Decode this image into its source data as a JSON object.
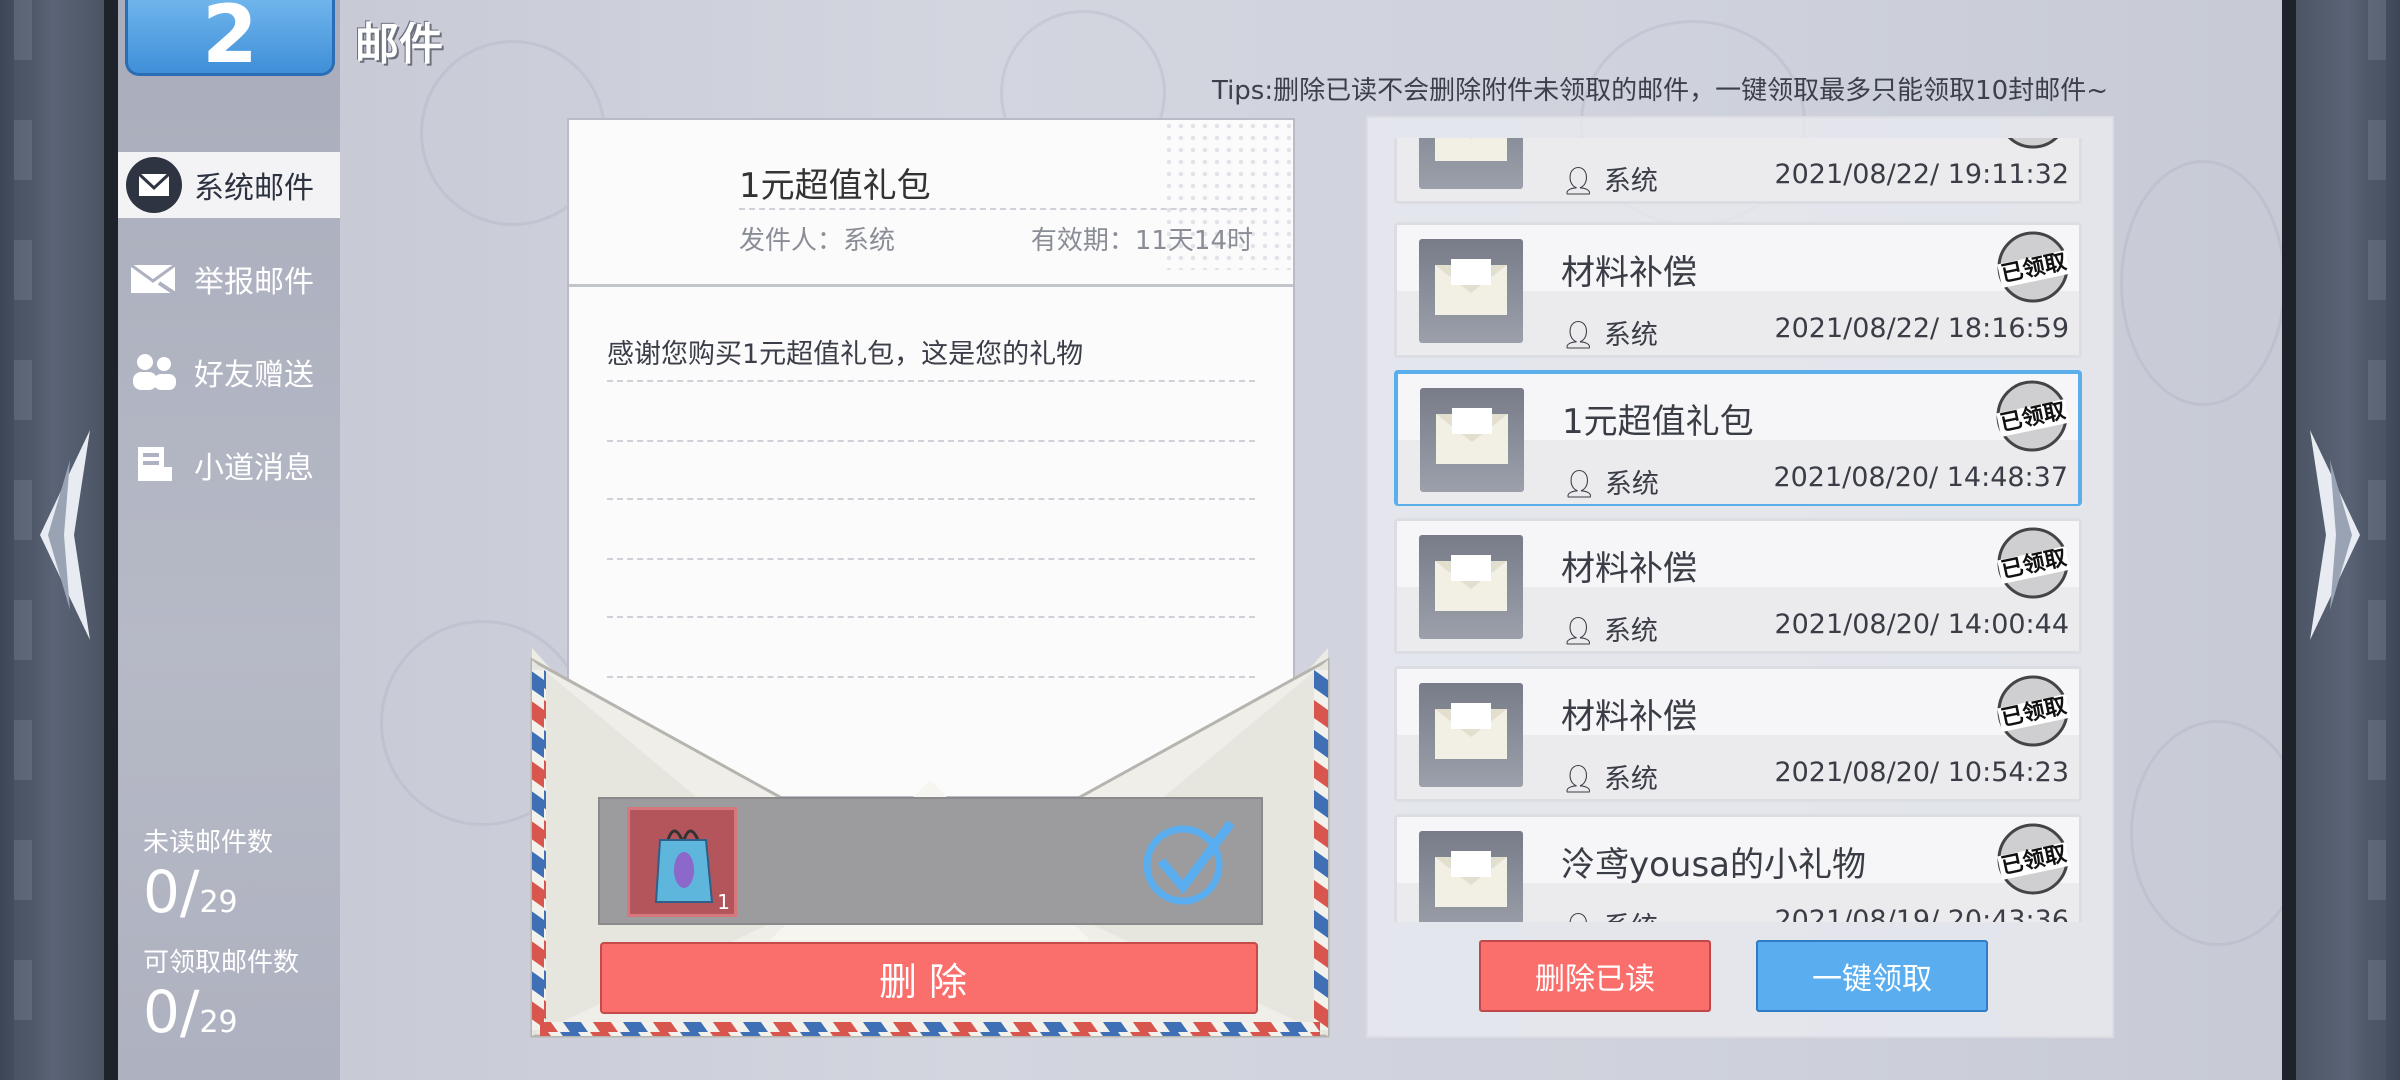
{
  "header": {
    "title": "邮件",
    "back_number": "2"
  },
  "tips": "Tips:删除已读不会删除附件未领取的邮件，一键领取最多只能领取10封邮件~",
  "sidebar": {
    "items": [
      {
        "label": "系统邮件",
        "icon": "mail-icon",
        "active": true
      },
      {
        "label": "举报邮件",
        "icon": "report-mail-icon",
        "active": false
      },
      {
        "label": "好友赠送",
        "icon": "friends-icon",
        "active": false
      },
      {
        "label": "小道消息",
        "icon": "news-icon",
        "active": false
      }
    ],
    "unread_label": "未读邮件数",
    "unread_value": "0/",
    "unread_total": "29",
    "claimable_label": "可领取邮件数",
    "claimable_value": "0/",
    "claimable_total": "29"
  },
  "detail": {
    "title": "1元超值礼包",
    "sender": "发件人：系统",
    "expiry": "有效期：11天14时",
    "body": "感谢您购买1元超值礼包，这是您的礼物",
    "attachment_count": "1",
    "delete_label": "删除"
  },
  "mail_list": [
    {
      "title": "",
      "sender": "系统",
      "time": "2021/08/22/ 19:11:32",
      "claimed": true,
      "selected": false
    },
    {
      "title": "材料补偿",
      "sender": "系统",
      "time": "2021/08/22/ 18:16:59",
      "claimed": true,
      "selected": false
    },
    {
      "title": "1元超值礼包",
      "sender": "系统",
      "time": "2021/08/20/ 14:48:37",
      "claimed": true,
      "selected": true
    },
    {
      "title": "材料补偿",
      "sender": "系统",
      "time": "2021/08/20/ 14:00:44",
      "claimed": true,
      "selected": false
    },
    {
      "title": "材料补偿",
      "sender": "系统",
      "time": "2021/08/20/ 10:54:23",
      "claimed": true,
      "selected": false
    },
    {
      "title": "泠鸢yousa的小礼物",
      "sender": "系统",
      "time": "2021/08/19/ 20:43:36",
      "claimed": true,
      "selected": false
    }
  ],
  "stamp_text": "已领取",
  "actions": {
    "delete_read": "删除已读",
    "claim_all": "一键领取"
  },
  "colors": {
    "accent_blue": "#5aaef0",
    "danger_red": "#fa6e6c"
  }
}
